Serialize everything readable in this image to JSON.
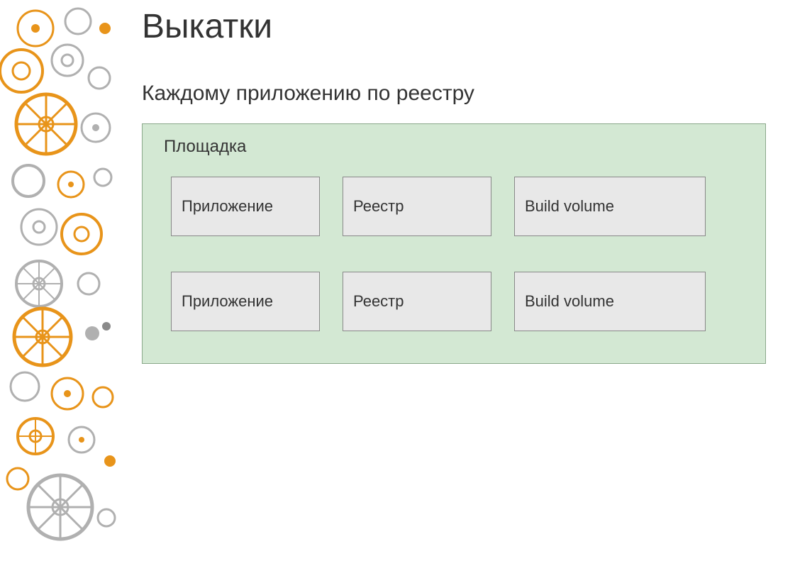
{
  "title": "Выкатки",
  "subtitle": "Каждому приложению по реестру",
  "platform": {
    "label": "Площадка",
    "rows": [
      {
        "app": "Приложение",
        "registry": "Реестр",
        "volume": "Build volume"
      },
      {
        "app": "Приложение",
        "registry": "Реестр",
        "volume": "Build volume"
      }
    ]
  },
  "colors": {
    "platform_bg": "#d3e8d3",
    "box_bg": "#e8e8e8",
    "orange": "#e8941a",
    "gray": "#b0b0b0"
  }
}
